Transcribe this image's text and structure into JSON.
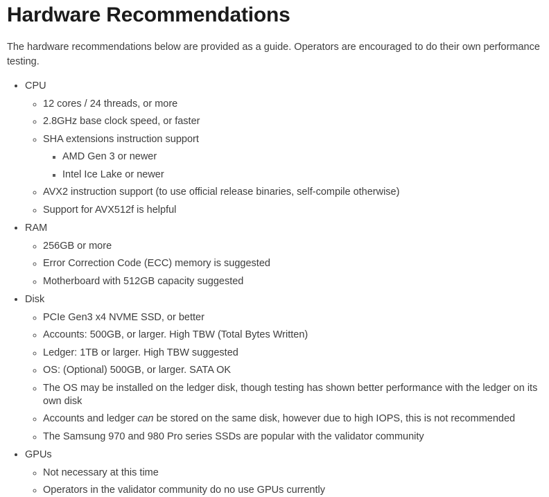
{
  "page": {
    "title": "Hardware Recommendations",
    "intro": "The hardware recommendations below are provided as a guide. Operators are encouraged to do their own performance testing.",
    "colors": {
      "heading": "#1b1b1b",
      "body": "#3d3d3d",
      "background": "#ffffff"
    }
  },
  "sections": [
    {
      "label": "CPU",
      "items": [
        {
          "text": "12 cores / 24 threads, or more"
        },
        {
          "text": "2.8GHz base clock speed, or faster"
        },
        {
          "text": "SHA extensions instruction support",
          "subitems": [
            {
              "text": "AMD Gen 3 or newer"
            },
            {
              "text": "Intel Ice Lake or newer"
            }
          ]
        },
        {
          "text": "AVX2 instruction support (to use official release binaries, self-compile otherwise)"
        },
        {
          "text": "Support for AVX512f is helpful"
        }
      ]
    },
    {
      "label": "RAM",
      "items": [
        {
          "text": "256GB or more"
        },
        {
          "text": "Error Correction Code (ECC) memory is suggested"
        },
        {
          "text": "Motherboard with 512GB capacity suggested"
        }
      ]
    },
    {
      "label": "Disk",
      "items": [
        {
          "text": "PCIe Gen3 x4 NVME SSD, or better"
        },
        {
          "text": "Accounts: 500GB, or larger. High TBW (Total Bytes Written)"
        },
        {
          "text": "Ledger: 1TB or larger. High TBW suggested"
        },
        {
          "text": "OS: (Optional) 500GB, or larger. SATA OK"
        },
        {
          "text": "The OS may be installed on the ledger disk, though testing has shown better performance with the ledger on its own disk"
        },
        {
          "text_before": "Accounts and ledger ",
          "emphasis": "can",
          "text_after": " be stored on the same disk, however due to high IOPS, this is not recommended"
        },
        {
          "text": "The Samsung 970 and 980 Pro series SSDs are popular with the validator community"
        }
      ]
    },
    {
      "label": "GPUs",
      "items": [
        {
          "text": "Not necessary at this time"
        },
        {
          "text": "Operators in the validator community do no use GPUs currently"
        }
      ]
    }
  ]
}
